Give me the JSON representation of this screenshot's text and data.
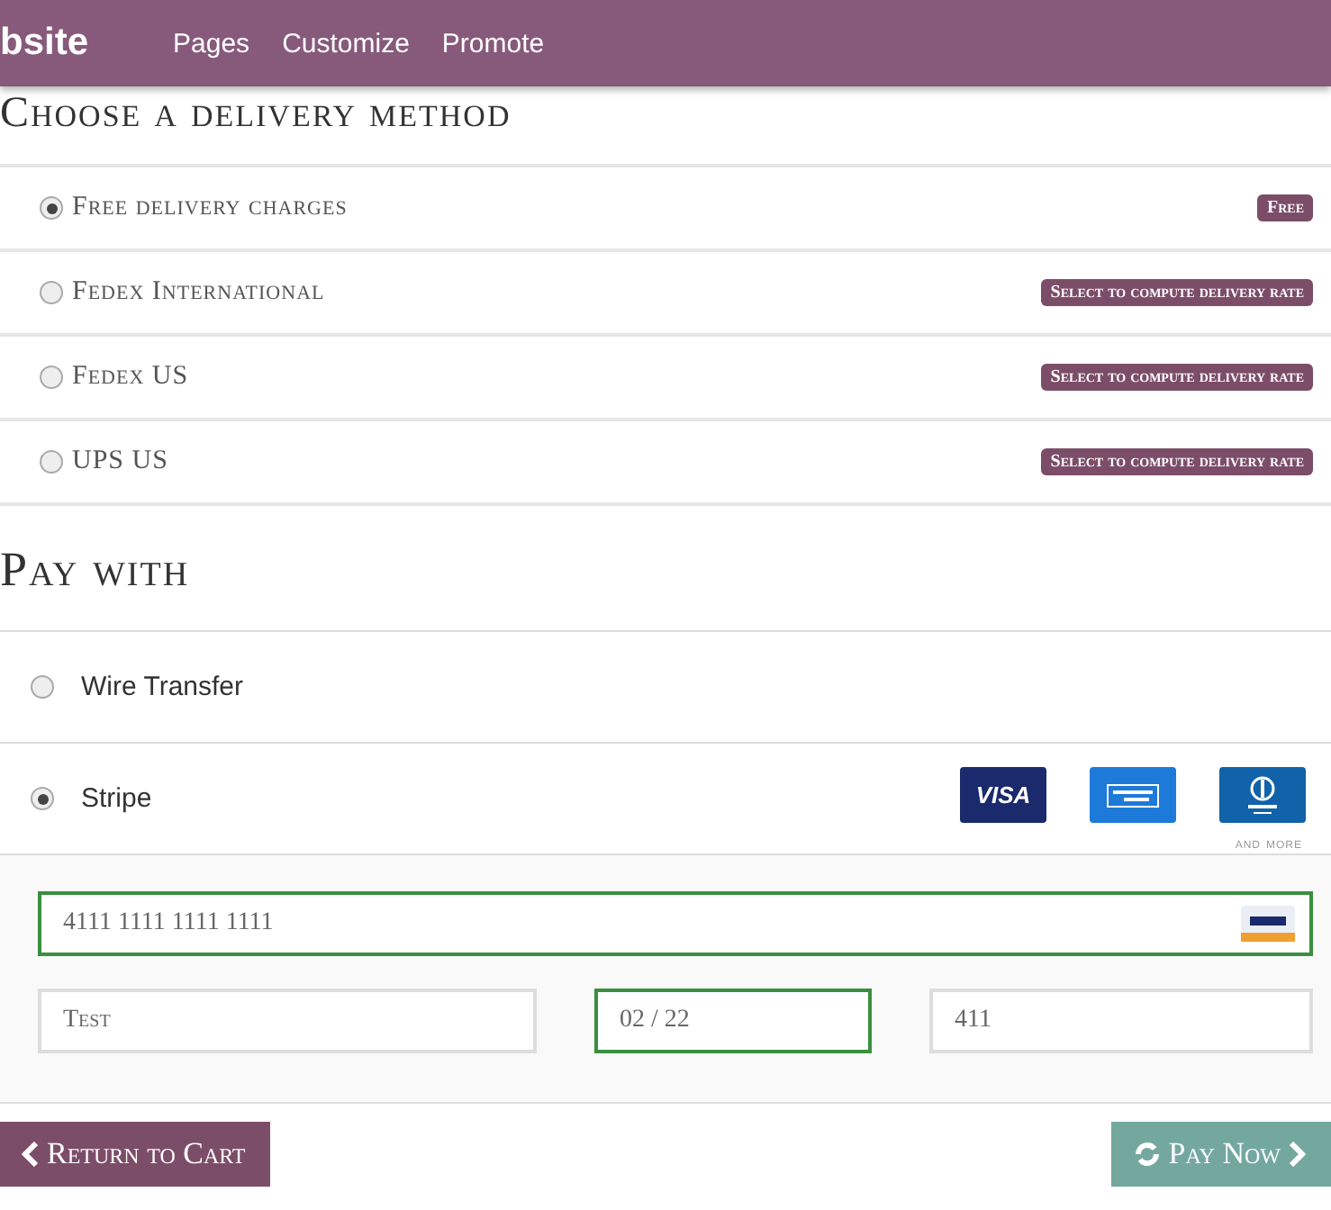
{
  "topbar": {
    "brand": "bsite",
    "menu": [
      "Pages",
      "Customize",
      "Promote"
    ]
  },
  "delivery": {
    "title": "Choose a delivery method",
    "methods": [
      {
        "name": "Free delivery charges",
        "selected": true,
        "badge": "Free"
      },
      {
        "name": "Fedex International",
        "selected": false,
        "badge": "Select to compute delivery rate"
      },
      {
        "name": "Fedex US",
        "selected": false,
        "badge": "Select to compute delivery rate"
      },
      {
        "name": "UPS US",
        "selected": false,
        "badge": "Select to compute delivery rate"
      }
    ]
  },
  "payment": {
    "title": "Pay with",
    "methods": [
      {
        "name": "Wire Transfer",
        "selected": false
      },
      {
        "name": "Stripe",
        "selected": true
      }
    ],
    "cards": [
      {
        "kind": "visa",
        "label": "VISA"
      },
      {
        "kind": "amex"
      },
      {
        "kind": "diners"
      }
    ],
    "and_more": "and more",
    "card_number": {
      "value": "4111 1111 1111 1111",
      "valid": true
    },
    "fields": [
      {
        "value": "Test",
        "valid": false
      },
      {
        "value": "02 / 22",
        "valid": true
      },
      {
        "value": "411",
        "valid": false
      }
    ]
  },
  "buttons": {
    "back": "Return to Cart",
    "pay": "Pay Now"
  }
}
